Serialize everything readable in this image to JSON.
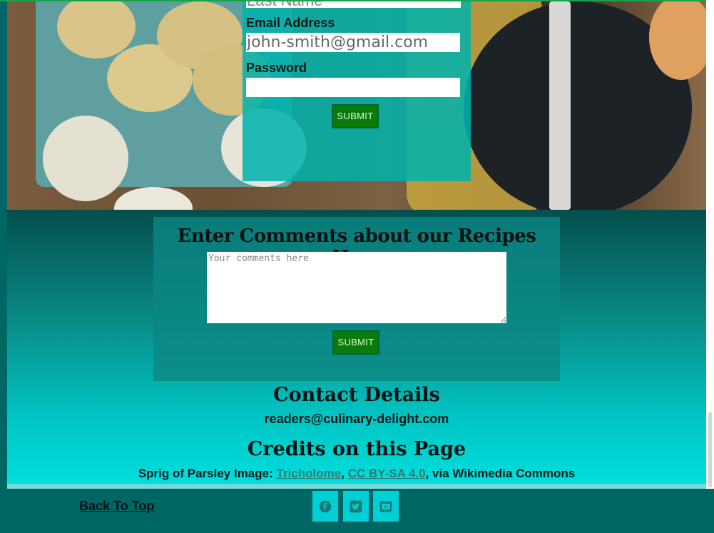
{
  "registration": {
    "last_name_cut": "Last Name",
    "email_label": "Email Address",
    "email_value": "john-smith@gmail.com",
    "password_label": "Password",
    "password_value": "",
    "submit_label": "SUBMIT"
  },
  "comments": {
    "heading": "Enter Comments about our Recipes Here",
    "placeholder": "Your comments here",
    "submit_label": "SUBMIT"
  },
  "contact": {
    "heading": "Contact Details",
    "email": "readers@culinary-delight.com"
  },
  "credits": {
    "heading": "Credits on this Page",
    "prefix": "Sprig of Parsley Image: ",
    "author": "Tricholome",
    "sep1": ", ",
    "license": "CC BY-SA 4.0",
    "suffix": ", via Wikimedia Commons"
  },
  "footer": {
    "back_to_top": "Back To Top",
    "social": [
      "facebook-icon",
      "twitter-icon",
      "youtube-icon"
    ]
  },
  "colors": {
    "accent": "#00cfd6",
    "button": "#0a7a0a",
    "footer": "#006664"
  }
}
